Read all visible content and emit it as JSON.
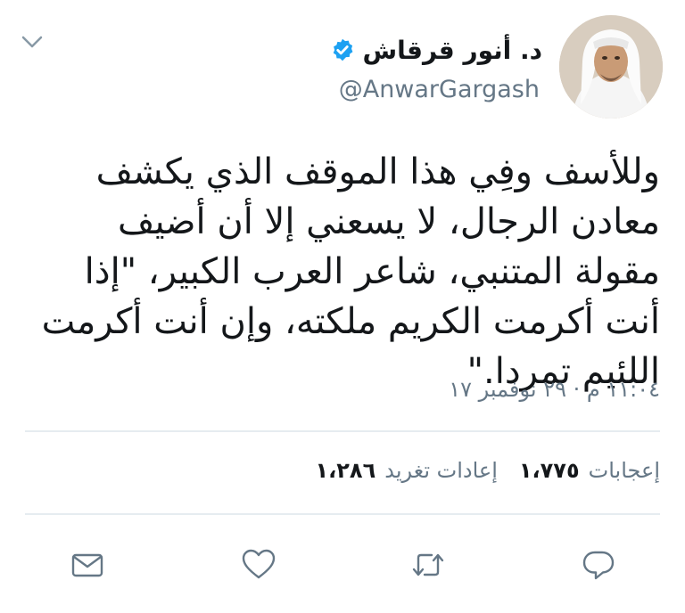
{
  "tweet": {
    "display_name": "د. أنور قرقاش",
    "handle": "@AnwarGargash",
    "text": "وللأسف وفِي هذا الموقف الذي يكشف معادن الرجال، لا يسعني إلا أن أضيف مقولة المتنبي، شاعر العرب الكبير، \"إذا أنت أكرمت الكريم ملكته، وإن أنت أكرمت اللئيم تمردا.\"",
    "timestamp": "١١:٠٤ م · ٢٩ نوفمبر ١٧"
  },
  "stats": {
    "retweets_count": "١،٢٨٦",
    "retweets_label": "إعادات تغريد",
    "likes_count": "١،٧٧٥",
    "likes_label": "إعجابات"
  },
  "colors": {
    "verified_blue": "#1da1f2",
    "secondary_text": "#657786",
    "divider": "#e6ecf0"
  },
  "icons": {
    "menu": "chevron-down-icon",
    "verified": "verified-badge-icon",
    "reply": "reply-icon",
    "retweet": "retweet-icon",
    "like": "heart-icon",
    "message": "envelope-icon"
  }
}
